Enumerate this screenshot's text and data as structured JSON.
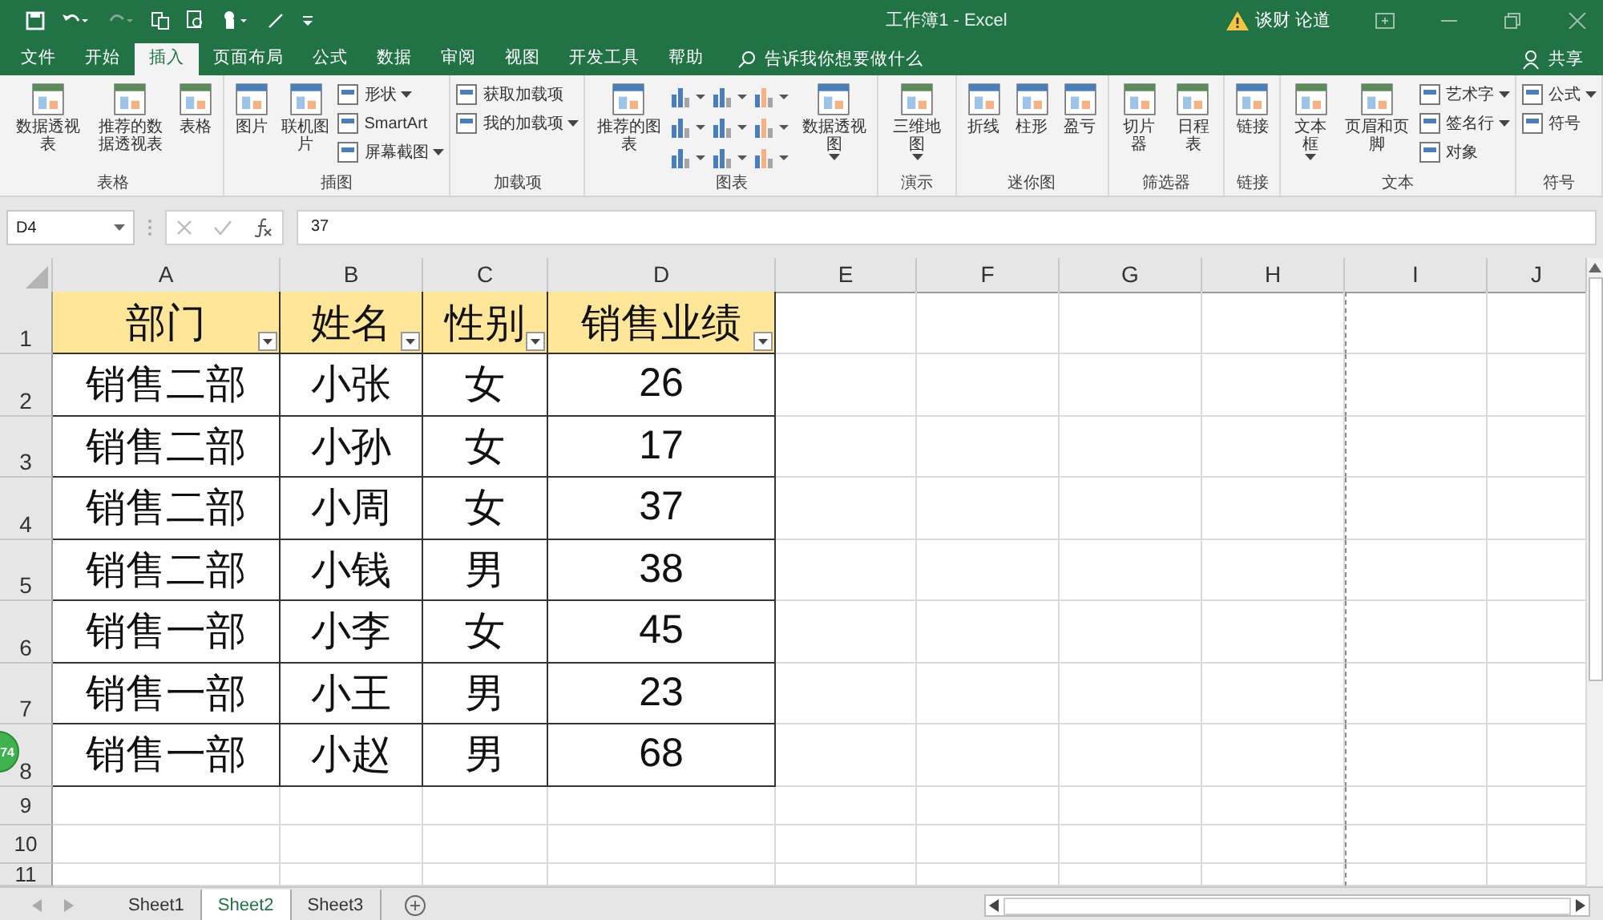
{
  "title_bar": {
    "title": "工作簿1  -  Excel",
    "user": "谈财 论道"
  },
  "menu_tabs": [
    {
      "label": "文件",
      "selected": false
    },
    {
      "label": "开始",
      "selected": false
    },
    {
      "label": "插入",
      "selected": true
    },
    {
      "label": "页面布局",
      "selected": false
    },
    {
      "label": "公式",
      "selected": false
    },
    {
      "label": "数据",
      "selected": false
    },
    {
      "label": "审阅",
      "selected": false
    },
    {
      "label": "视图",
      "selected": false
    },
    {
      "label": "开发工具",
      "selected": false
    },
    {
      "label": "帮助",
      "selected": false
    }
  ],
  "tell_me": "告诉我你想要做什么",
  "share": "共享",
  "ribbon_groups": [
    {
      "name": "表格",
      "items": [
        {
          "kind": "large",
          "label": "数据透视表",
          "dropdown": false
        },
        {
          "kind": "large",
          "label": "推荐的数据透视表",
          "dropdown": false
        },
        {
          "kind": "large",
          "label": "表格",
          "dropdown": false
        }
      ]
    },
    {
      "name": "插图",
      "items": [
        {
          "kind": "large",
          "label": "图片",
          "dropdown": false
        },
        {
          "kind": "large",
          "label": "联机图片",
          "dropdown": false
        },
        {
          "kind": "stack",
          "items": [
            {
              "label": "形状",
              "dropdown": true
            },
            {
              "label": "SmartArt",
              "dropdown": false
            },
            {
              "label": "屏幕截图",
              "dropdown": true
            }
          ]
        }
      ]
    },
    {
      "name": "加载项",
      "items": [
        {
          "kind": "stack",
          "items": [
            {
              "label": "获取加载项",
              "dropdown": false
            },
            {
              "label": "我的加载项",
              "dropdown": true
            }
          ]
        }
      ]
    },
    {
      "name": "图表",
      "items": [
        {
          "kind": "large",
          "label": "推荐的图表",
          "dropdown": false
        },
        {
          "kind": "chart_grid"
        },
        {
          "kind": "large",
          "label": "数据透视图",
          "dropdown": true
        }
      ]
    },
    {
      "name": "演示",
      "items": [
        {
          "kind": "large",
          "label": "三维地图",
          "dropdown": true
        }
      ]
    },
    {
      "name": "迷你图",
      "items": [
        {
          "kind": "large",
          "label": "折线",
          "dropdown": false
        },
        {
          "kind": "large",
          "label": "柱形",
          "dropdown": false
        },
        {
          "kind": "large",
          "label": "盈亏",
          "dropdown": false
        }
      ]
    },
    {
      "name": "筛选器",
      "items": [
        {
          "kind": "large",
          "label": "切片器",
          "dropdown": false
        },
        {
          "kind": "large",
          "label": "日程表",
          "dropdown": false
        }
      ]
    },
    {
      "name": "链接",
      "items": [
        {
          "kind": "large",
          "label": "链接",
          "dropdown": false
        }
      ]
    },
    {
      "name": "文本",
      "items": [
        {
          "kind": "large",
          "label": "文本框",
          "dropdown": true
        },
        {
          "kind": "large",
          "label": "页眉和页脚",
          "dropdown": false
        },
        {
          "kind": "stack",
          "items": [
            {
              "label": "艺术字",
              "dropdown": true
            },
            {
              "label": "签名行",
              "dropdown": true
            },
            {
              "label": "对象",
              "dropdown": false
            }
          ]
        }
      ]
    },
    {
      "name": "符号",
      "items": [
        {
          "kind": "stack",
          "items": [
            {
              "label": "公式",
              "dropdown": true
            },
            {
              "label": "符号",
              "dropdown": false
            }
          ]
        }
      ]
    }
  ],
  "formula_bar": {
    "name_box": "D4",
    "formula": "37"
  },
  "columns": [
    "A",
    "B",
    "C",
    "D",
    "E",
    "F",
    "G",
    "H",
    "I",
    "J"
  ],
  "rows": [
    {
      "number": "1",
      "kind": "header",
      "cells": [
        {
          "text": "部门",
          "filter": true
        },
        {
          "text": "姓名",
          "filter": true
        },
        {
          "text": "性别",
          "filter": true
        },
        {
          "text": "销售业绩",
          "filter": true
        }
      ]
    },
    {
      "number": "2",
      "kind": "data",
      "cells": [
        {
          "text": "销售二部"
        },
        {
          "text": "小张"
        },
        {
          "text": "女"
        },
        {
          "text": "26"
        }
      ]
    },
    {
      "number": "3",
      "kind": "data",
      "cells": [
        {
          "text": "销售二部"
        },
        {
          "text": "小孙"
        },
        {
          "text": "女"
        },
        {
          "text": "17"
        }
      ]
    },
    {
      "number": "4",
      "kind": "data",
      "cells": [
        {
          "text": "销售二部"
        },
        {
          "text": "小周"
        },
        {
          "text": "女"
        },
        {
          "text": "37"
        }
      ]
    },
    {
      "number": "5",
      "kind": "data",
      "cells": [
        {
          "text": "销售二部"
        },
        {
          "text": "小钱"
        },
        {
          "text": "男"
        },
        {
          "text": "38"
        }
      ]
    },
    {
      "number": "6",
      "kind": "data",
      "cells": [
        {
          "text": "销售一部"
        },
        {
          "text": "小李"
        },
        {
          "text": "女"
        },
        {
          "text": "45"
        }
      ]
    },
    {
      "number": "7",
      "kind": "data",
      "cells": [
        {
          "text": "销售一部"
        },
        {
          "text": "小王"
        },
        {
          "text": "男"
        },
        {
          "text": "23"
        }
      ]
    },
    {
      "number": "8",
      "kind": "data",
      "cells": [
        {
          "text": "销售一部"
        },
        {
          "text": "小赵"
        },
        {
          "text": "男"
        },
        {
          "text": "68"
        }
      ]
    },
    {
      "number": "9",
      "kind": "empty",
      "cells": []
    },
    {
      "number": "10",
      "kind": "empty",
      "cells": []
    },
    {
      "number": "11",
      "kind": "empty",
      "cells": []
    }
  ],
  "floating_badge": "74",
  "sheet_tabs": [
    {
      "label": "Sheet1",
      "selected": false
    },
    {
      "label": "Sheet2",
      "selected": true
    },
    {
      "label": "Sheet3",
      "selected": false
    }
  ]
}
